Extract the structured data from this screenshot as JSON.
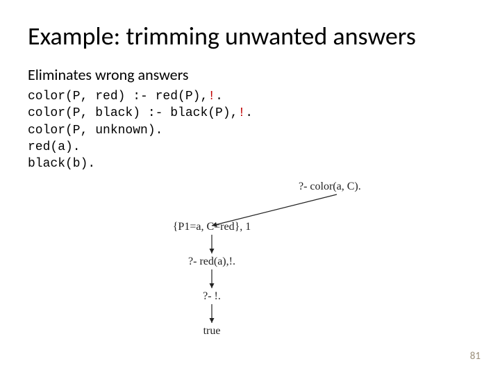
{
  "title": "Example: trimming unwanted answers",
  "subtitle": "Eliminates wrong answers",
  "code": {
    "l1a": "color(P, red) :- red(P),",
    "l1b": "!",
    "l1c": ".",
    "l2a": "color(P, black) :- black(P),",
    "l2b": "!",
    "l2c": ".",
    "l3": "color(P, unknown).",
    "l4": "red(a).",
    "l5": "black(b)."
  },
  "diagram": {
    "query": "?- color(a, C).",
    "binding": "{P1=a, C=red}, 1",
    "step1": "?- red(a),!.",
    "step2": "?- !.",
    "result": "true"
  },
  "page_number": "81"
}
